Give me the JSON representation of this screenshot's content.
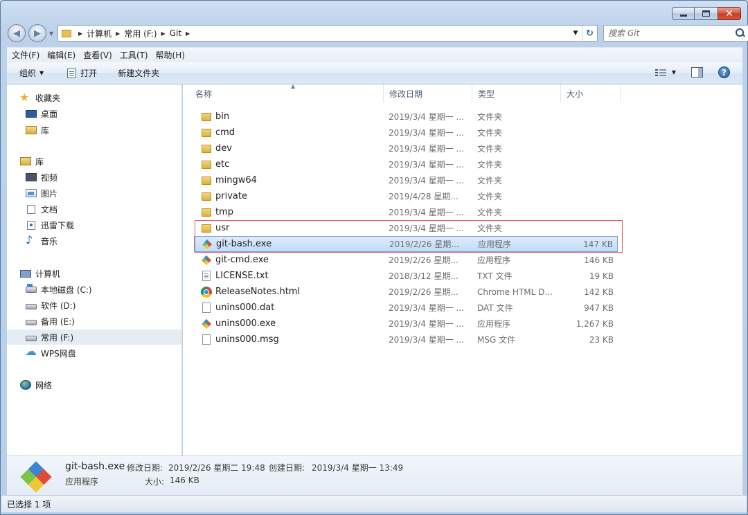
{
  "caption": {
    "minimize": "",
    "maximize": "",
    "close": "✕"
  },
  "address": {
    "crumbs": [
      "计算机",
      "常用 (F:)",
      "Git"
    ],
    "search_placeholder": "搜索 Git"
  },
  "menu": [
    "文件(F)",
    "编辑(E)",
    "查看(V)",
    "工具(T)",
    "帮助(H)"
  ],
  "commands": {
    "organize": "组织",
    "open": "打开",
    "new_folder": "新建文件夹",
    "help": "?"
  },
  "nav": {
    "favorites": "收藏夹",
    "desktop": "桌面",
    "library_fav": "库",
    "library": "库",
    "video": "视频",
    "pictures": "图片",
    "documents": "文档",
    "xunlei": "迅雷下载",
    "music": "音乐",
    "computer": "计算机",
    "drive_c": "本地磁盘 (C:)",
    "drive_d": "软件 (D:)",
    "drive_e": "备用 (E:)",
    "drive_f": "常用 (F:)",
    "wps": "WPS网盘",
    "network": "网络"
  },
  "columns": {
    "name": "名称",
    "date": "修改日期",
    "type": "类型",
    "size": "大小"
  },
  "files": [
    {
      "name": "bin",
      "date": "2019/3/4 星期一 ...",
      "type": "文件夹",
      "size": "",
      "icon": "folder-icon"
    },
    {
      "name": "cmd",
      "date": "2019/3/4 星期一 ...",
      "type": "文件夹",
      "size": "",
      "icon": "folder-icon"
    },
    {
      "name": "dev",
      "date": "2019/3/4 星期一 ...",
      "type": "文件夹",
      "size": "",
      "icon": "folder-icon"
    },
    {
      "name": "etc",
      "date": "2019/3/4 星期一 ...",
      "type": "文件夹",
      "size": "",
      "icon": "folder-icon"
    },
    {
      "name": "mingw64",
      "date": "2019/3/4 星期一 ...",
      "type": "文件夹",
      "size": "",
      "icon": "folder-icon"
    },
    {
      "name": "private",
      "date": "2019/4/28 星期...",
      "type": "文件夹",
      "size": "",
      "icon": "folder-icon"
    },
    {
      "name": "tmp",
      "date": "2019/3/4 星期一 ...",
      "type": "文件夹",
      "size": "",
      "icon": "folder-icon"
    },
    {
      "name": "usr",
      "date": "2019/3/4 星期一 ...",
      "type": "文件夹",
      "size": "",
      "icon": "folder-icon"
    },
    {
      "name": "git-bash.exe",
      "date": "2019/2/26 星期...",
      "type": "应用程序",
      "size": "147 KB",
      "icon": "git-icon"
    },
    {
      "name": "git-cmd.exe",
      "date": "2019/2/26 星期...",
      "type": "应用程序",
      "size": "146 KB",
      "icon": "git-icon"
    },
    {
      "name": "LICENSE.txt",
      "date": "2018/3/12 星期...",
      "type": "TXT 文件",
      "size": "19 KB",
      "icon": "text-file-icon"
    },
    {
      "name": "ReleaseNotes.html",
      "date": "2019/2/26 星期...",
      "type": "Chrome HTML D...",
      "size": "142 KB",
      "icon": "chrome-icon"
    },
    {
      "name": "unins000.dat",
      "date": "2019/3/4 星期一 ...",
      "type": "DAT 文件",
      "size": "947 KB",
      "icon": "file-icon"
    },
    {
      "name": "unins000.exe",
      "date": "2019/3/4 星期一 ...",
      "type": "应用程序",
      "size": "1,267 KB",
      "icon": "git-icon"
    },
    {
      "name": "unins000.msg",
      "date": "2019/3/4 星期一 ...",
      "type": "MSG 文件",
      "size": "23 KB",
      "icon": "file-icon"
    }
  ],
  "selected_index": 8,
  "details": {
    "name": "git-bash.exe",
    "type": "应用程序",
    "modified_label": "修改日期:",
    "modified": "2019/2/26 星期二 19:48",
    "created_label": "创建日期:",
    "created": "2019/3/4 星期一 13:49",
    "size_label": "大小:",
    "size": "146 KB"
  },
  "status": "已选择 1 项",
  "colors": {
    "selection": "#c2dcf8",
    "highlight_border": "#e05a5a",
    "folder": "#ddb140"
  }
}
